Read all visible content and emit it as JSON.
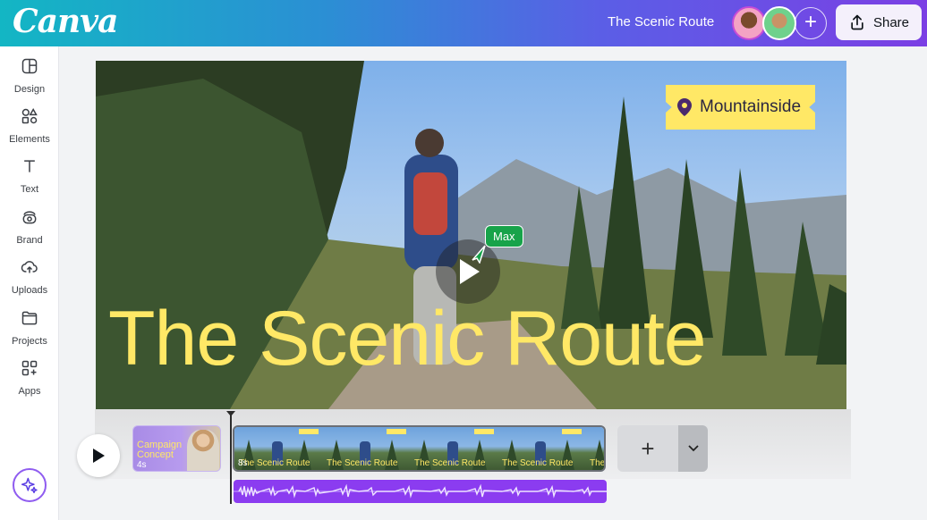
{
  "header": {
    "logo": "Canva",
    "doc_title": "The Scenic Route",
    "share_label": "Share",
    "add_label": "+"
  },
  "sidebar": {
    "items": [
      {
        "label": "Design",
        "icon": "layout-icon"
      },
      {
        "label": "Elements",
        "icon": "shapes-icon"
      },
      {
        "label": "Text",
        "icon": "text-icon"
      },
      {
        "label": "Brand",
        "icon": "brand-icon"
      },
      {
        "label": "Uploads",
        "icon": "upload-cloud-icon"
      },
      {
        "label": "Projects",
        "icon": "folder-icon"
      },
      {
        "label": "Apps",
        "icon": "apps-icon"
      }
    ]
  },
  "canvas": {
    "location_tag": "Mountainside",
    "collaborator_cursor": "Max",
    "title_text": "The Scenic Route"
  },
  "timeline": {
    "clips": [
      {
        "title": "Campaign Concept",
        "duration": "4s"
      },
      {
        "duration": "8s",
        "caption": "The Scenic Route"
      }
    ],
    "add_label": "+"
  },
  "colors": {
    "accent_yellow": "#ffe866",
    "brand_purple": "#7b3fe4",
    "brand_teal": "#13b6c4",
    "cursor_green": "#17a34a",
    "audio_purple": "#8b3cf0"
  }
}
